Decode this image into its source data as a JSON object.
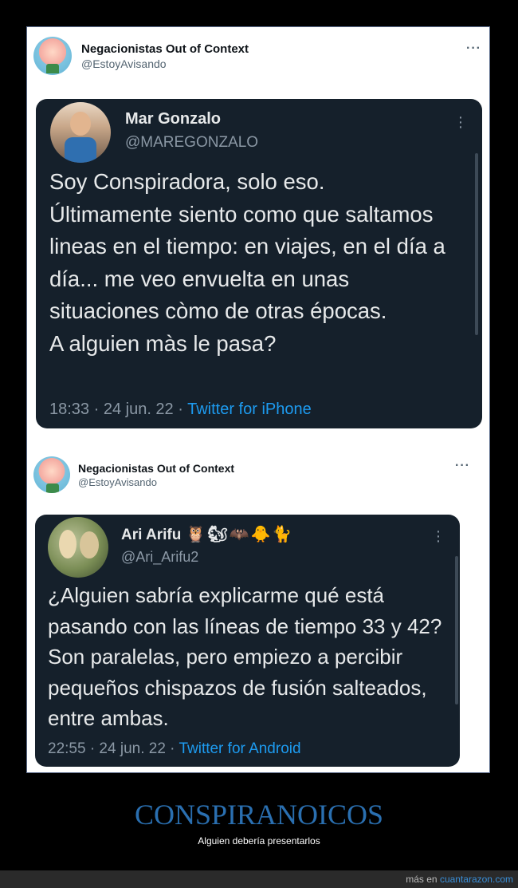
{
  "outer_tweet_1": {
    "name": "Negacionistas Out of Context",
    "handle": "@EstoyAvisando",
    "menu_glyph": "···"
  },
  "embedded_tweet_1": {
    "name": "Mar Gonzalo",
    "handle": "@MAREGONZALO",
    "text": "Soy Conspiradora, solo eso.\nÚltimamente siento como que saltamos lineas en el tiempo: en viajes, en el día a día... me veo envuelta en unas situaciones còmo de otras épocas.\nA alguien màs le pasa?",
    "time": "18:33 · 24 jun. 22 · ",
    "source": "Twitter for iPhone"
  },
  "outer_tweet_2": {
    "name": "Negacionistas Out of Context",
    "handle": "@EstoyAvisando",
    "menu_glyph": "···"
  },
  "embedded_tweet_2": {
    "name": "Ari Arifu",
    "emojis": "🦉🐿🦇🐥🐈",
    "handle": "@Ari_Arifu2",
    "text": "¿Alguien sabría explicarme qué está pasando con las líneas de tiempo 33 y 42? Son paralelas, pero empiezo a percibir pequeños chispazos de fusión salteados, entre ambas.",
    "time": "22:55 · 24 jun. 22 · ",
    "source": "Twitter for Android"
  },
  "caption": {
    "title": "CONSPIRANOICOS",
    "subtitle": "Alguien debería presentarlos"
  },
  "footer": {
    "prefix": "más en ",
    "link": "cuantarazon.com"
  },
  "colors": {
    "dark_card": "#15202b",
    "link_blue": "#1d9bf0",
    "caption_blue": "#2a6fb0"
  }
}
